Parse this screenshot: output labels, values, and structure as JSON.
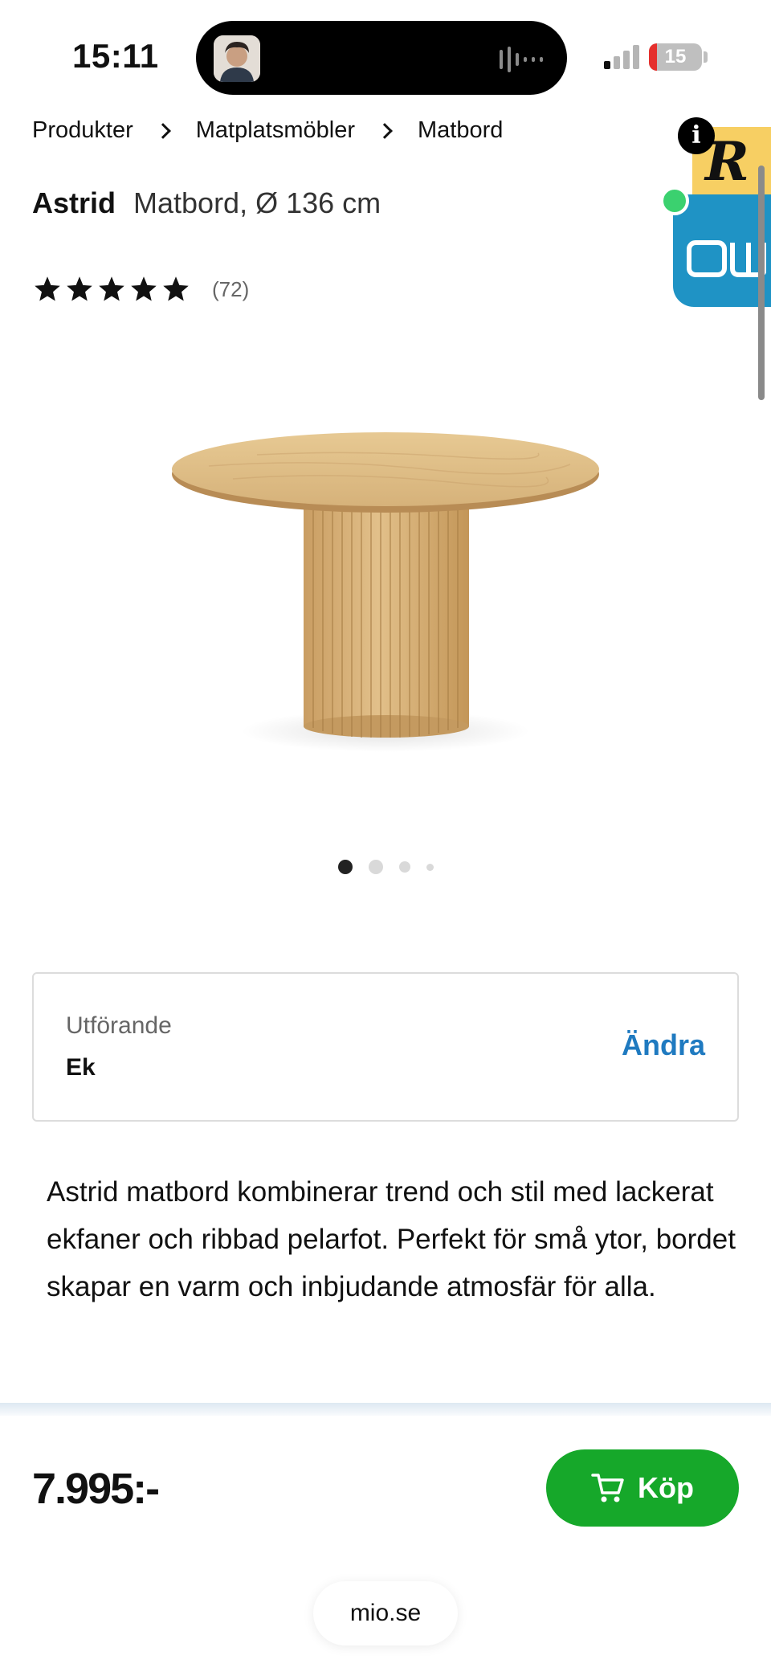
{
  "status_bar": {
    "time": "15:11",
    "battery_level": "15",
    "battery_fraction": 0.15,
    "battery_color": "#e5302d"
  },
  "breadcrumb": {
    "items": [
      "Produkter",
      "Matplatsmöbler",
      "Matbord"
    ]
  },
  "product": {
    "brand": "Astrid",
    "description_short": "Matbord, Ø 136 cm",
    "rating": 5,
    "review_count": "(72)",
    "image_count": 4,
    "active_image": 0,
    "description": "Astrid matbord kombinerar trend och stil med lackerat ekfaner och ribbad pelarfot. Perfekt för små ytor, bordet skapar en varm och inbjudande atmosfär för alla."
  },
  "variant": {
    "label": "Utförande",
    "value": "Ek",
    "change_label": "Ändra"
  },
  "purchase": {
    "price": "7.995:-",
    "buy_label": "Köp",
    "buy_color": "#16a82a"
  },
  "browser": {
    "url": "mio.se"
  },
  "colors": {
    "accent_link": "#1f7ac0",
    "widget_yellow": "#f7cf63",
    "widget_blue": "#1f93c5"
  }
}
